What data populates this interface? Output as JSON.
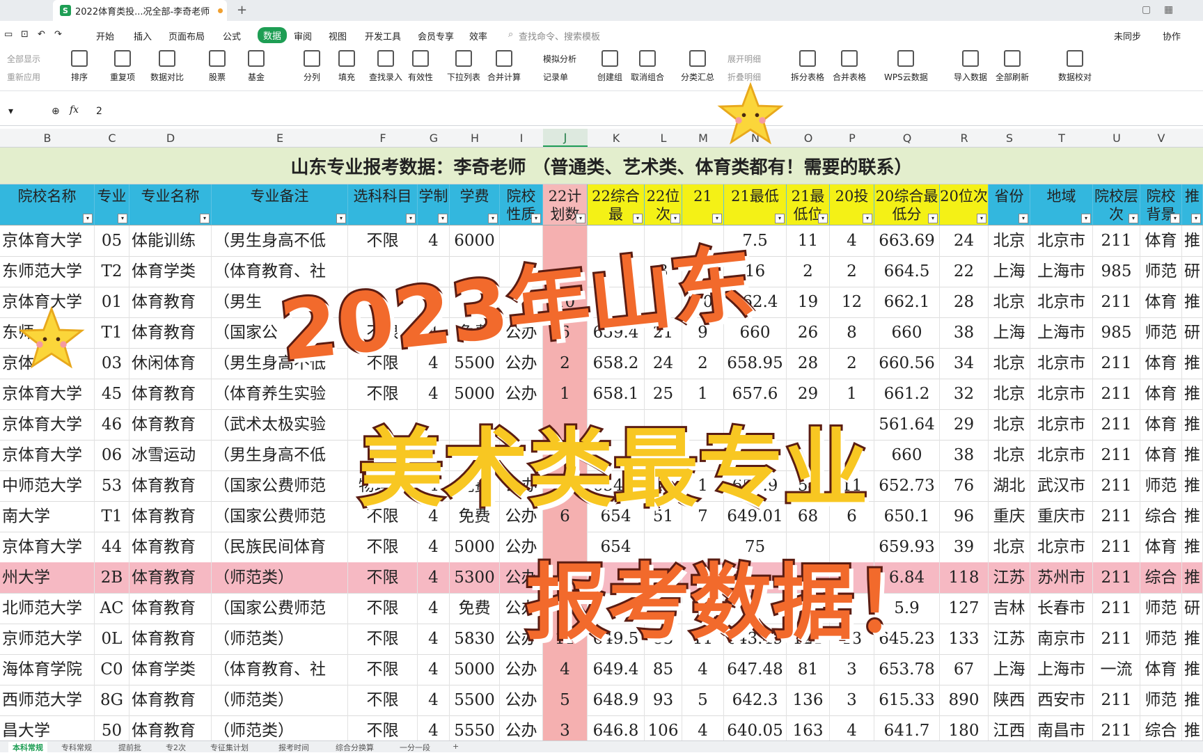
{
  "tab": {
    "title": "2022体育类投...况全部-李奇老师",
    "logo": "S",
    "new_tab": "+"
  },
  "menu": [
    "开始",
    "插入",
    "页面布局",
    "公式",
    "数据",
    "审阅",
    "视图",
    "开发工具",
    "会员专享",
    "效率"
  ],
  "menu_active": "数据",
  "search_hint": "查找命令、搜索模板",
  "right_menu": [
    "未同步",
    "协作"
  ],
  "ribbon": [
    {
      "label": "排序"
    },
    {
      "label": "重复项"
    },
    {
      "label": "数据对比"
    },
    {
      "label": "股票"
    },
    {
      "label": "基金"
    },
    {
      "label": "分列"
    },
    {
      "label": "填充"
    },
    {
      "label": "查找录入"
    },
    {
      "label": "有效性"
    },
    {
      "label": "下拉列表"
    },
    {
      "label": "合并计算"
    },
    {
      "label": "创建组"
    },
    {
      "label": "取消组合"
    },
    {
      "label": "分类汇总"
    },
    {
      "label": "拆分表格"
    },
    {
      "label": "合并表格"
    },
    {
      "label": "WPS云数据"
    },
    {
      "label": "导入数据"
    },
    {
      "label": "全部刷新"
    },
    {
      "label": "数据校对"
    }
  ],
  "ribbon_small": {
    "show_all": "全部显示",
    "reapply": "重新应用",
    "sim": "模拟分析",
    "record": "记录单",
    "expand": "展开明细",
    "collapse": "折叠明细"
  },
  "formula": {
    "fx": "fx",
    "value": "2"
  },
  "columns": [
    "B",
    "C",
    "D",
    "E",
    "F",
    "G",
    "H",
    "I",
    "J",
    "K",
    "L",
    "M",
    "N",
    "O",
    "P",
    "Q",
    "R",
    "S",
    "T",
    "U",
    "V"
  ],
  "selected_column": "J",
  "banner": "山东专业报考数据：李奇老师 （普通类、艺术类、体育类都有！需要的联系）",
  "headers": [
    "院校名称",
    "专业",
    "专业名称",
    "专业备注",
    "选科科目",
    "学制",
    "学费",
    "院校性质",
    "22计划数",
    "22综合最",
    "22位次",
    "21",
    "21最低",
    "21最低位",
    "20投",
    "20综合最低分",
    "20位次",
    "省份",
    "地域",
    "院校层次",
    "院校背景",
    "推"
  ],
  "rows": [
    [
      "京体育大学",
      "05",
      "体能训练",
      "（男生身高不低",
      "不限",
      "4",
      "6000",
      "",
      "",
      "",
      "",
      "",
      "7.5",
      "11",
      "4",
      "663.69",
      "24",
      "北京",
      "北京市",
      "211",
      "体育",
      "推"
    ],
    [
      "东师范大学",
      "T2",
      "体育学类",
      "（体育教育、社",
      "",
      "",
      "",
      "",
      "",
      "",
      "3",
      "",
      "16",
      "2",
      "2",
      "664.5",
      "22",
      "上海",
      "上海市",
      "985",
      "师范",
      "研"
    ],
    [
      "京体育大学",
      "01",
      "体育教育",
      "（男生",
      "",
      "",
      "",
      "",
      "10",
      "",
      "9",
      "10",
      "662.4",
      "19",
      "12",
      "662.1",
      "28",
      "北京",
      "北京市",
      "211",
      "体育",
      "推"
    ],
    [
      "东师",
      "T1",
      "体育教育",
      "（国家公",
      "不限",
      "4",
      "免费",
      "公办",
      "6",
      "659.4",
      "21",
      "9",
      "660",
      "26",
      "8",
      "660",
      "38",
      "上海",
      "上海市",
      "985",
      "师范",
      "研"
    ],
    [
      "京体",
      "03",
      "休闲体育",
      "（男生身高不低",
      "不限",
      "4",
      "5500",
      "公办",
      "2",
      "658.2",
      "24",
      "2",
      "658.95",
      "28",
      "2",
      "660.56",
      "34",
      "北京",
      "北京市",
      "211",
      "体育",
      "推"
    ],
    [
      "京体育大学",
      "45",
      "体育教育",
      "（体育养生实验",
      "不限",
      "4",
      "5000",
      "公办",
      "1",
      "658.1",
      "25",
      "1",
      "657.6",
      "29",
      "1",
      "661.2",
      "32",
      "北京",
      "北京市",
      "211",
      "体育",
      "推"
    ],
    [
      "京体育大学",
      "46",
      "体育教育",
      "（武术太极实验",
      "",
      "",
      "",
      "",
      "",
      "",
      "",
      "",
      "",
      "",
      "",
      "561.64",
      "29",
      "北京",
      "北京市",
      "211",
      "体育",
      "推"
    ],
    [
      "京体育大学",
      "06",
      "冰雪运动",
      "（男生身高不低",
      "",
      "",
      "",
      "",
      "",
      "",
      "",
      "",
      "",
      "",
      "",
      "660",
      "38",
      "北京",
      "北京市",
      "211",
      "体育",
      "推"
    ],
    [
      "中师范大学",
      "53",
      "体育教育",
      "（国家公费师范",
      "物理或",
      "4",
      "免费",
      "公办",
      "10",
      "654.9",
      "46",
      "1",
      "651.9",
      "54",
      "11",
      "652.73",
      "76",
      "湖北",
      "武汉市",
      "211",
      "师范",
      "推"
    ],
    [
      "南大学",
      "T1",
      "体育教育",
      "（国家公费师范",
      "不限",
      "4",
      "免费",
      "公办",
      "6",
      "654",
      "51",
      "7",
      "649.01",
      "68",
      "6",
      "650.1",
      "96",
      "重庆",
      "重庆市",
      "211",
      "综合",
      "推"
    ],
    [
      "京体育大学",
      "44",
      "体育教育",
      "（民族民间体育",
      "不限",
      "4",
      "5000",
      "公办",
      "",
      "654",
      "",
      "",
      "75",
      "",
      "",
      "659.93",
      "39",
      "北京",
      "北京市",
      "211",
      "体育",
      "推"
    ],
    [
      "州大学",
      "2B",
      "体育教育",
      "（师范类）",
      "不限",
      "4",
      "5300",
      "公办",
      "",
      "",
      "",
      "",
      "",
      "",
      "",
      "6.84",
      "118",
      "江苏",
      "苏州市",
      "211",
      "综合",
      "推"
    ],
    [
      "北师范大学",
      "AC",
      "体育教育",
      "（国家公费师范",
      "不限",
      "4",
      "免费",
      "公办",
      "",
      "",
      "",
      "",
      "",
      "",
      "",
      "5.9",
      "127",
      "吉林",
      "长春市",
      "211",
      "师范",
      "研"
    ],
    [
      "京师范大学",
      "0L",
      "体育教育",
      "（师范类）",
      "不限",
      "4",
      "5830",
      "公办",
      "11",
      "649.5",
      "83",
      "11",
      "643.49",
      "121",
      "13",
      "645.23",
      "133",
      "江苏",
      "南京市",
      "211",
      "师范",
      "推"
    ],
    [
      "海体育学院",
      "C0",
      "体育学类",
      "（体育教育、社",
      "不限",
      "4",
      "5000",
      "公办",
      "4",
      "649.4",
      "85",
      "4",
      "647.48",
      "81",
      "3",
      "653.78",
      "67",
      "上海",
      "上海市",
      "一流",
      "体育",
      "推"
    ],
    [
      "西师范大学",
      "8G",
      "体育教育",
      "（师范类）",
      "不限",
      "4",
      "5500",
      "公办",
      "5",
      "648.9",
      "93",
      "5",
      "642.3",
      "136",
      "3",
      "615.33",
      "890",
      "陕西",
      "西安市",
      "211",
      "师范",
      "推"
    ],
    [
      "昌大学",
      "50",
      "体育教育",
      "（师范类）",
      "不限",
      "4",
      "5550",
      "公办",
      "3",
      "646.8",
      "106",
      "4",
      "640.05",
      "163",
      "4",
      "641.7",
      "180",
      "江西",
      "南昌市",
      "211",
      "综合",
      "推"
    ]
  ],
  "highlight_row": 11,
  "sheet_tabs": [
    "本科常规",
    "专科常规",
    "提前批",
    "专2次",
    "专征集计划",
    "报考时间",
    "综合分换算",
    "一分一段"
  ],
  "overlay": {
    "line1": "2023年山东",
    "line2": "美术类最专业",
    "line3": "报考数据！"
  },
  "colors": {
    "accent": "#1e9e54",
    "header_blue": "#33b7de",
    "header_yellow": "#f4f116",
    "highlight_row": "#f6b9c3",
    "banner_bg": "#e3eecd",
    "overlay_orange": "#f26a2c",
    "overlay_yellow": "#f8c722"
  },
  "icons": {
    "star": "star-sticker-icon",
    "search": "search-icon",
    "zoom": "zoom-icon",
    "filter": "filter-dropdown-icon"
  }
}
